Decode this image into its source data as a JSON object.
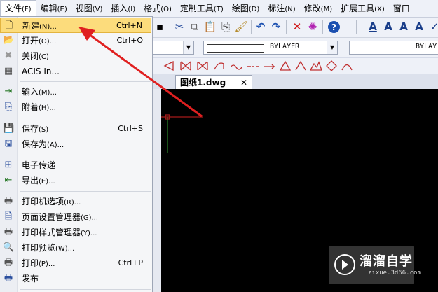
{
  "menubar": {
    "items": [
      {
        "label": "文件",
        "key": "(F)"
      },
      {
        "label": "编辑",
        "key": "(E)"
      },
      {
        "label": "视图",
        "key": "(V)"
      },
      {
        "label": "插入",
        "key": "(I)"
      },
      {
        "label": "格式",
        "key": "(O)"
      },
      {
        "label": "定制工具",
        "key": "(T)"
      },
      {
        "label": "绘图",
        "key": "(D)"
      },
      {
        "label": "标注",
        "key": "(N)"
      },
      {
        "label": "修改",
        "key": "(M)"
      },
      {
        "label": "扩展工具",
        "key": "(X)"
      },
      {
        "label": "窗口",
        "key": ""
      }
    ]
  },
  "file_menu": {
    "items": [
      {
        "label": "新建",
        "key": "(N)...",
        "shortcut": "Ctrl+N",
        "icon": "new-file-icon",
        "glyph": "🗋"
      },
      {
        "label": "打开",
        "key": "(O)...",
        "shortcut": "Ctrl+O",
        "icon": "open-folder-icon",
        "glyph": "📂"
      },
      {
        "label": "关闭",
        "key": "(C)",
        "shortcut": "",
        "icon": "close-file-icon",
        "glyph": "✖"
      },
      {
        "label": "ACIS In...",
        "key": "",
        "shortcut": "",
        "icon": "acis-icon",
        "glyph": "▦"
      },
      {
        "label": "输入",
        "key": "(M)...",
        "shortcut": "",
        "icon": "import-icon",
        "glyph": "⇥"
      },
      {
        "label": "附着",
        "key": "(H)...",
        "shortcut": "",
        "icon": "attach-icon",
        "glyph": "⎘"
      },
      {
        "label": "保存",
        "key": "(S)",
        "shortcut": "Ctrl+S",
        "icon": "save-icon",
        "glyph": "💾"
      },
      {
        "label": "保存为",
        "key": "(A)...",
        "shortcut": "",
        "icon": "save-as-icon",
        "glyph": "🖫"
      },
      {
        "label": "电子传递",
        "key": "",
        "shortcut": "",
        "icon": "etransmit-icon",
        "glyph": "⊞"
      },
      {
        "label": "导出",
        "key": "(E)...",
        "shortcut": "",
        "icon": "export-icon",
        "glyph": "⇤"
      },
      {
        "label": "打印机选项",
        "key": "(R)...",
        "shortcut": "",
        "icon": "printer-options-icon",
        "glyph": "🖶"
      },
      {
        "label": "页面设置管理器",
        "key": "(G)...",
        "shortcut": "",
        "icon": "page-setup-icon",
        "glyph": "🗎"
      },
      {
        "label": "打印样式管理器",
        "key": "(Y)...",
        "shortcut": "",
        "icon": "plot-style-icon",
        "glyph": "🖶"
      },
      {
        "label": "打印预览",
        "key": "(W)...",
        "shortcut": "",
        "icon": "print-preview-icon",
        "glyph": "🔍"
      },
      {
        "label": "打印",
        "key": "(P)...",
        "shortcut": "Ctrl+P",
        "icon": "print-icon",
        "glyph": "🖶"
      },
      {
        "label": "发布",
        "key": "",
        "shortcut": "",
        "icon": "publish-icon",
        "glyph": "🖶"
      }
    ]
  },
  "properties": {
    "linetype": "BYLAYER",
    "lineweight": "BYLAY"
  },
  "document": {
    "tab_label": "图纸1.dwg",
    "close_glyph": "✕"
  },
  "watermark": {
    "title": "溜溜自学",
    "url": "zixue.3d66.com"
  },
  "colors": {
    "highlight": "#fcdc7c",
    "annotation_arrow": "#e02020",
    "canvas": "#000000"
  }
}
